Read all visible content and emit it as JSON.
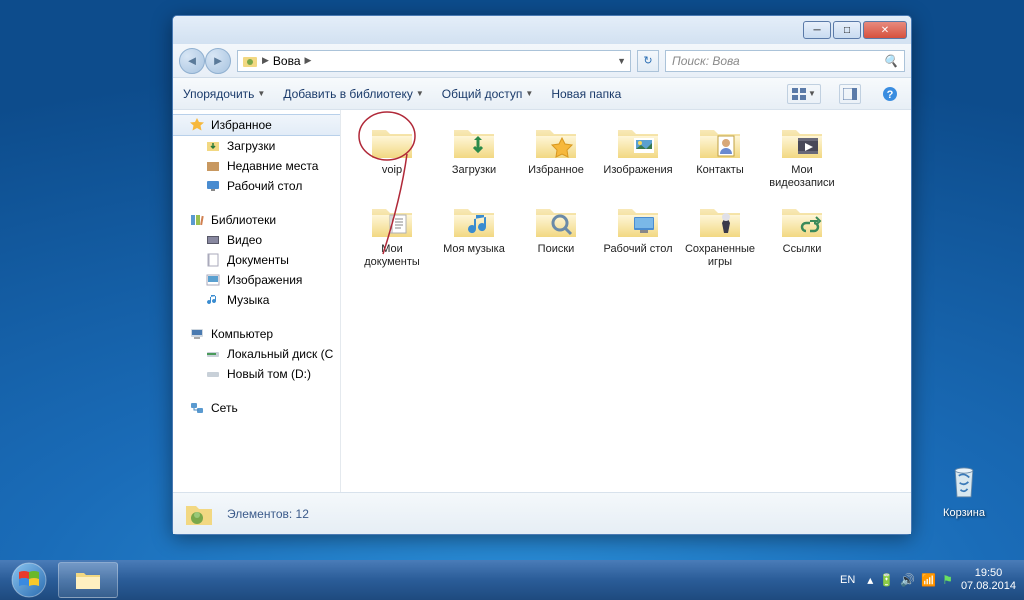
{
  "desktop": {
    "recycle_bin": "Корзина"
  },
  "window": {
    "breadcrumb": {
      "root": "Вова"
    },
    "search_placeholder": "Поиск: Вова",
    "toolbar": {
      "organize": "Упорядочить",
      "add_library": "Добавить в библиотеку",
      "share_with": "Общий доступ",
      "new_folder": "Новая папка"
    },
    "sidebar": {
      "favorites": {
        "label": "Избранное",
        "items": [
          "Загрузки",
          "Недавние места",
          "Рабочий стол"
        ]
      },
      "libraries": {
        "label": "Библиотеки",
        "items": [
          "Видео",
          "Документы",
          "Изображения",
          "Музыка"
        ]
      },
      "computer": {
        "label": "Компьютер",
        "items": [
          "Локальный диск (C",
          "Новый том (D:)"
        ]
      },
      "network": {
        "label": "Сеть"
      }
    },
    "folders": [
      {
        "name": "voip",
        "overlay": ""
      },
      {
        "name": "Загрузки",
        "overlay": "download"
      },
      {
        "name": "Избранное",
        "overlay": "star"
      },
      {
        "name": "Изображения",
        "overlay": "picture"
      },
      {
        "name": "Контакты",
        "overlay": "contact"
      },
      {
        "name": "Мои видеозаписи",
        "overlay": "video"
      },
      {
        "name": "Мои документы",
        "overlay": "doc"
      },
      {
        "name": "Моя музыка",
        "overlay": "music"
      },
      {
        "name": "Поиски",
        "overlay": "search"
      },
      {
        "name": "Рабочий стол",
        "overlay": "desktop"
      },
      {
        "name": "Сохраненные игры",
        "overlay": "game"
      },
      {
        "name": "Ссылки",
        "overlay": "link"
      }
    ],
    "status": {
      "elements_label": "Элементов:",
      "count": "12"
    }
  },
  "taskbar": {
    "lang": "EN",
    "time": "19:50",
    "date": "07.08.2014"
  }
}
